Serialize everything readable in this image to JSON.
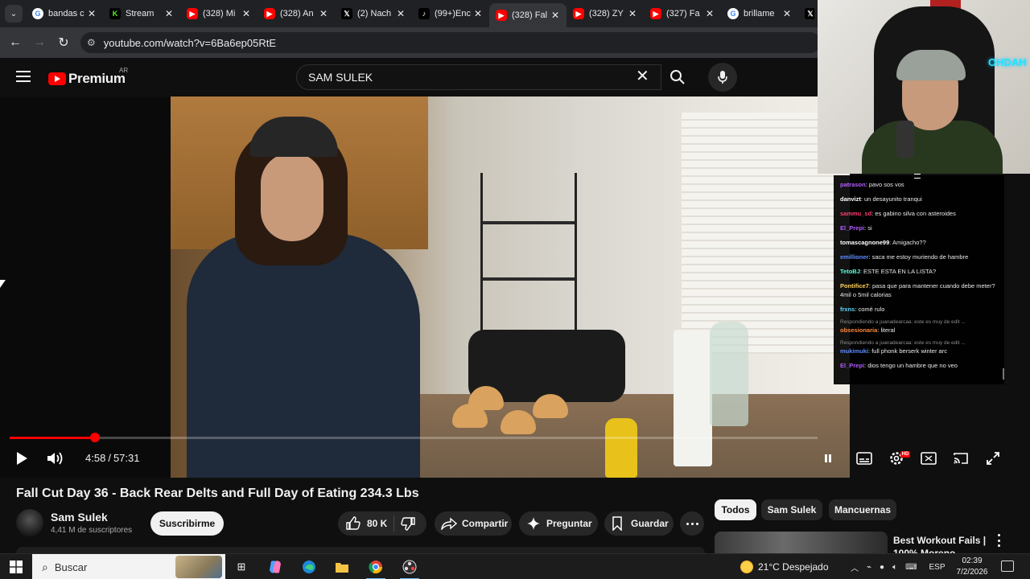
{
  "browser": {
    "tabs": [
      {
        "favicon": "google-icon",
        "title": "bandas c",
        "active": false
      },
      {
        "favicon": "kick-icon",
        "title": "Stream",
        "active": false
      },
      {
        "favicon": "youtube-icon",
        "title": "(328) Mi",
        "active": false
      },
      {
        "favicon": "youtube-icon",
        "title": "(328) An",
        "active": false
      },
      {
        "favicon": "x-icon",
        "title": "(2) Nach",
        "active": false
      },
      {
        "favicon": "tiktok-icon",
        "title": "(99+)Enc",
        "active": false
      },
      {
        "favicon": "youtube-icon",
        "title": "(328) Fal",
        "active": true
      },
      {
        "favicon": "youtube-icon",
        "title": "(328) ZY",
        "active": false
      },
      {
        "favicon": "youtube-icon",
        "title": "(327) Fa",
        "active": false
      },
      {
        "favicon": "google-icon",
        "title": "brillame",
        "active": false
      }
    ],
    "url": "youtube.com/watch?v=6Ba6ep05RtE"
  },
  "youtube": {
    "brand": "Premium",
    "region": "AR",
    "search_query": "SAM SULEK"
  },
  "player": {
    "current_time": "4:58",
    "separator": "/",
    "duration": "57:31",
    "progress_fraction": 0.0864,
    "hd_badge": "HD"
  },
  "video": {
    "title": "Fall Cut Day 36 - Back Rear Delts and Full Day of Eating 234.3 Lbs",
    "channel_name": "Sam Sulek",
    "subscribers": "4,41 M de suscriptores",
    "subscribe_label": "Suscribirme",
    "like_count": "80 K",
    "share_label": "Compartir",
    "ask_label": "Preguntar",
    "save_label": "Guardar"
  },
  "chips": [
    {
      "label": "Todos",
      "active": true
    },
    {
      "label": "Sam Sulek",
      "active": false
    },
    {
      "label": "Mancuernas",
      "active": false
    }
  ],
  "recommendation": {
    "title": "Best Workout Fails | 100% Moreno"
  },
  "chat": {
    "messages": [
      {
        "user": "patrason",
        "color": "#b45cff",
        "text": "pavo sos vos"
      },
      {
        "user": "danvizt",
        "color": "#ffffff",
        "text": "un desayunito tranqui"
      },
      {
        "user": "sammu_sd",
        "color": "#ff3d6e",
        "text": "es gabino silva con asteroides"
      },
      {
        "user": "El_Prepi",
        "color": "#b45cff",
        "text": "si"
      },
      {
        "user": "tomascagnone99",
        "color": "#ffffff",
        "text": "Amigacho??"
      },
      {
        "user": "emillioner",
        "color": "#5c8dff",
        "text": "saca me estoy muriendo de hambre"
      },
      {
        "user": "TetoBJ",
        "color": "#5cffe1",
        "text": "ESTE ESTA EN LA LISTA?"
      },
      {
        "user": "Pontifice7",
        "color": "#ffd35c",
        "text": "pasa que para mantener cuando debe meter? 4mil o 5mil calorias"
      },
      {
        "user": "frxns",
        "color": "#5cd8ff",
        "text": "comé rulo"
      },
      {
        "reply": "Respondiendo a juanadearcaa: este es muy de edit ...",
        "user": "obsesionaria",
        "color": "#ff8a3d",
        "text": "literal"
      },
      {
        "reply": "Respondiendo a juanadearcaa: este es muy de edit ...",
        "user": "mukimuki",
        "color": "#5c8dff",
        "text": "full phonk berserk winter arc"
      },
      {
        "user": "El_Prepi",
        "color": "#b45cff",
        "text": "dios tengo un hambre que no veo"
      }
    ],
    "webcam_neon": "OHDAH"
  },
  "taskbar": {
    "search_placeholder": "Buscar",
    "weather": "21°C Despejado",
    "language": "ESP",
    "time": "02:39",
    "date": "7/2/2026"
  }
}
